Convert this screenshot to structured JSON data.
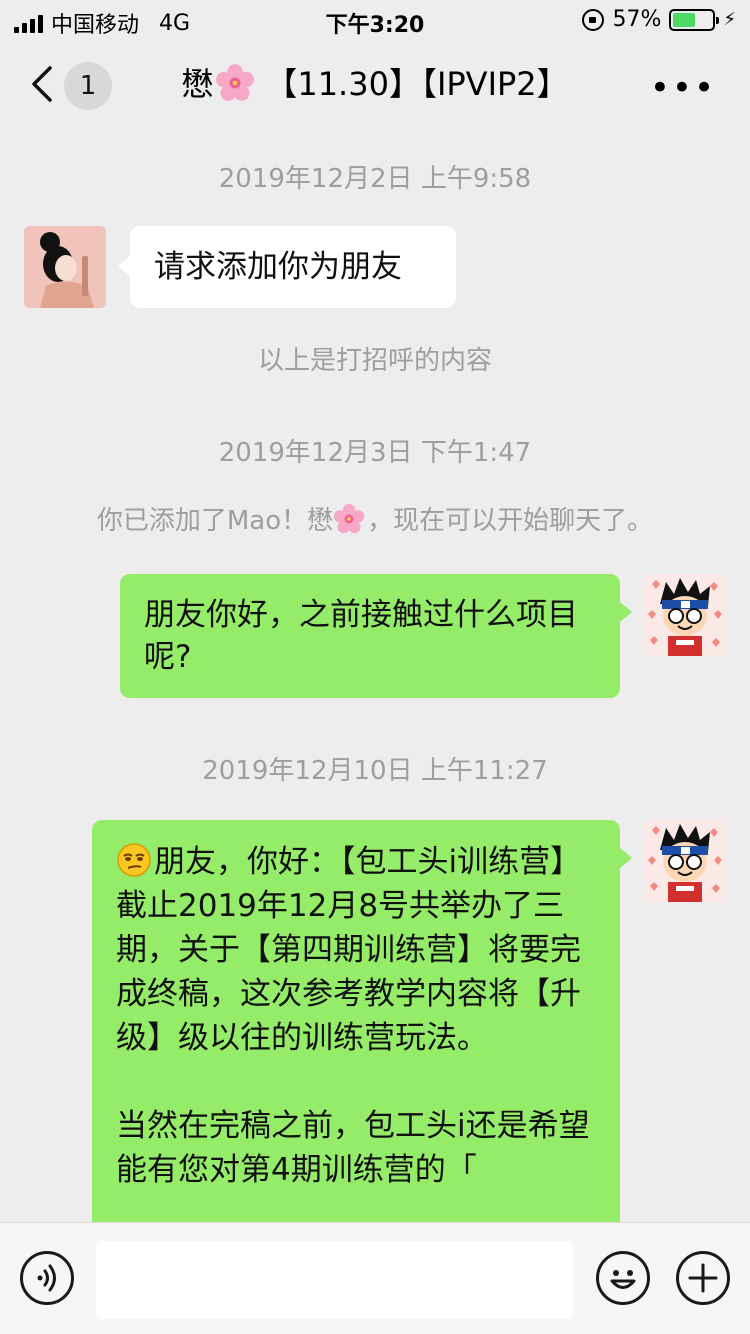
{
  "status": {
    "carrier": "中国移动",
    "network": "4G",
    "time": "下午3:20",
    "battery_pct": "57%",
    "battery_level": 0.57
  },
  "nav": {
    "unread_count": "1",
    "title_prefix": "懋",
    "title_suffix": "【11.30】【IPVIP2】",
    "more_glyph": "•••"
  },
  "messages": {
    "t1": "2019年12月2日 上午9:58",
    "m1": "请求添加你为朋友",
    "sys1": "以上是打招呼的内容",
    "t2": "2019年12月3日 下午1:47",
    "sys2_a": "你已添加了Mao！懋",
    "sys2_b": "，现在可以开始聊天了。",
    "m2": "朋友你好，之前接触过什么项目呢?",
    "t3": "2019年12月10日 上午11:27",
    "m3_p1": "朋友，你好：【包工头i训练营】截止2019年12月8号共举办了三期，关于【第四期训练营】将要完成终稿，这次参考教学内容将【升级】级以往的训练营玩法。",
    "m3_p2": "当然在完稿之前，包工头i还是希望能有您对第4期训练营的「"
  },
  "icons": {
    "back": "chevron-left-icon",
    "more": "more-dots-icon",
    "voice": "voice-icon",
    "emoji": "emoji-icon",
    "plus": "plus-icon",
    "flower": "cherry-blossom-icon"
  },
  "colors": {
    "bubble_self": "#95ec69",
    "bubble_other": "#ffffff",
    "background": "#ededed",
    "battery": "#4cd964"
  }
}
